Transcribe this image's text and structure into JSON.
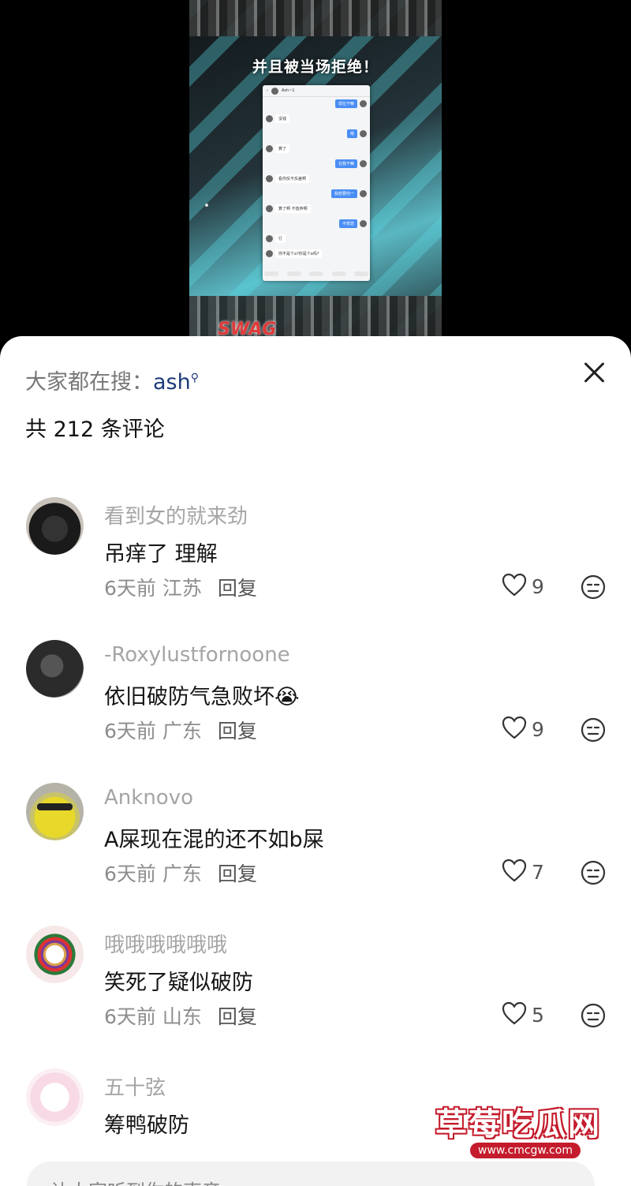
{
  "video": {
    "headline": "并且被当场拒绝！",
    "chat": {
      "contact": "Ash~1",
      "messages": [
        {
          "from": "me",
          "text": "现在干嘛"
        },
        {
          "from": "them",
          "text": "没钱"
        },
        {
          "from": "me",
          "text": "嗯"
        },
        {
          "from": "them",
          "text": "算了"
        },
        {
          "from": "me",
          "text": "在我干嘛"
        },
        {
          "from": "them",
          "text": "看你反不反差啊"
        },
        {
          "from": "me",
          "text": "我想要你一"
        },
        {
          "from": "them",
          "text": "算了啊 不放弃啊"
        },
        {
          "from": "me",
          "text": "不想您"
        },
        {
          "from": "them",
          "text": "行"
        },
        {
          "from": "them",
          "text": "你不是个a?你是个a吗?"
        }
      ],
      "time": "23:21"
    },
    "logo": "SWAG"
  },
  "sheet": {
    "search_prefix": "大家都在搜：",
    "search_term": "ash",
    "count_label": "共 212 条评论",
    "input_placeholder": "让大家听到你的声音",
    "reply_label": "回复"
  },
  "comments": [
    {
      "user": "看到女的就来劲",
      "text": "吊痒了 理解",
      "time": "6天前",
      "region": "江苏",
      "likes": "9"
    },
    {
      "user": "-Roxylustfornoone",
      "text": "依旧破防气急败坏😭",
      "time": "6天前",
      "region": "广东",
      "likes": "9"
    },
    {
      "user": "Anknovo",
      "text": "A屎现在混的还不如b屎",
      "time": "6天前",
      "region": "广东",
      "likes": "7"
    },
    {
      "user": "哦哦哦哦哦哦",
      "text": "笑死了疑似破防",
      "time": "6天前",
      "region": "山东",
      "likes": "5"
    },
    {
      "user": "五十弦",
      "text": "筹鸭破防",
      "time": "",
      "region": "",
      "likes": ""
    }
  ],
  "watermark": {
    "title": "草莓吃瓜网",
    "url": "www.cmcgw.com"
  }
}
